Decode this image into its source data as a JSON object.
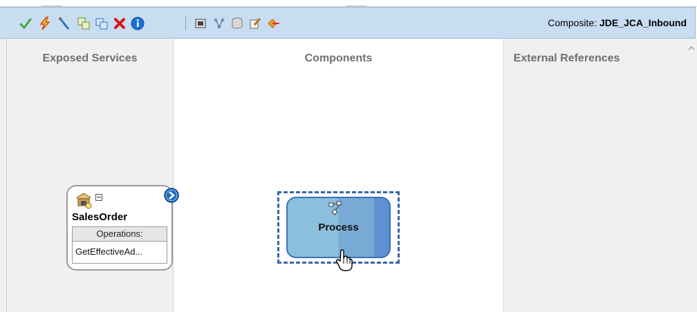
{
  "toolbar": {
    "icons": [
      "validate-icon",
      "deploy-icon",
      "wire-icon",
      "copy-icon",
      "paste-icon",
      "delete-icon",
      "info-icon",
      "test-icon",
      "layout-icon",
      "database-icon",
      "edit-icon",
      "refresh-icon"
    ],
    "composite_label": "Composite:",
    "composite_name": "JDE_JCA_Inbound"
  },
  "columns": {
    "exposed": "Exposed Services",
    "components": "Components",
    "external": "External References"
  },
  "service": {
    "name": "SalesOrder",
    "operations_header": "Operations:",
    "operation": "GetEffectiveAd..."
  },
  "component": {
    "name": "Process"
  },
  "colors": {
    "toolbar_bg": "#c8ddf2",
    "selection_border": "#3a64a8",
    "component_fill": "#8bbfdc"
  }
}
